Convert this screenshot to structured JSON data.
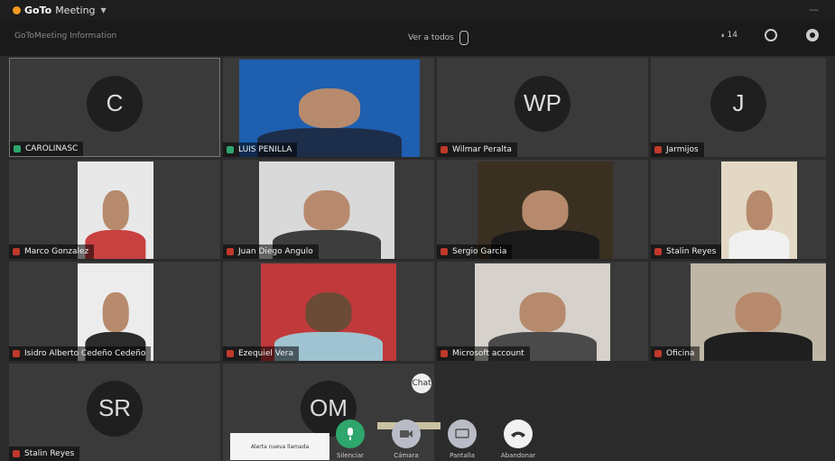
{
  "app": {
    "brand": "GoTo",
    "brand_suffix": "Meeting"
  },
  "toolbar": {
    "meeting_info": "GoToMeeting Information",
    "view_label": "Ver a todos"
  },
  "top_icons": {
    "participants_count": "14"
  },
  "participants": [
    {
      "initials": "C",
      "name": "CAROLINASC",
      "mic": "on",
      "active": true
    },
    {
      "initials": "",
      "name": "LUIS PENILLA",
      "mic": "on",
      "video": true
    },
    {
      "initials": "WP",
      "name": "Wilmar Peralta",
      "mic": "off"
    },
    {
      "initials": "J",
      "name": "Jarmijos",
      "mic": "off"
    },
    {
      "initials": "",
      "name": "Marco Gonzalez",
      "mic": "off",
      "video": true
    },
    {
      "initials": "",
      "name": "Juan Diego Angulo",
      "mic": "off",
      "video": true
    },
    {
      "initials": "",
      "name": "Sergio Garcia",
      "mic": "off",
      "video": true
    },
    {
      "initials": "",
      "name": "Stalin Reyes",
      "mic": "off",
      "video": true
    },
    {
      "initials": "",
      "name": "Isidro Alberto Cedeño Cedeño",
      "mic": "off",
      "video": true
    },
    {
      "initials": "",
      "name": "Ezequiel Vera",
      "mic": "off",
      "video": true
    },
    {
      "initials": "",
      "name": "Microsoft account",
      "mic": "off",
      "video": true
    },
    {
      "initials": "",
      "name": "Oficina",
      "mic": "off",
      "video": true
    },
    {
      "initials": "SR",
      "name": "Stalin Reyes",
      "mic": "off"
    },
    {
      "initials": "OM",
      "name": "",
      "mic": "off"
    }
  ],
  "controls": {
    "mic_label": "Silenciar",
    "camera_label": "Cámara",
    "share_label": "Pantalla",
    "leave_label": "Abandonar"
  },
  "toast": {
    "text": "Alerta nueva llamada"
  },
  "chat_bubble": {
    "text": "Chat"
  },
  "colors": {
    "accent": "#2ea66c",
    "muted": "#c0392b",
    "brand": "#f29a21"
  }
}
